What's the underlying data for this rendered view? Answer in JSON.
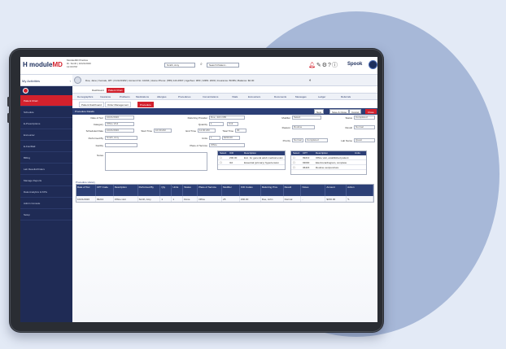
{
  "app": {
    "brand_prefix": "module",
    "brand_suffix": "MD",
    "header_info": [
      "ModuleMD Practice",
      "Dr. Smith | 10/21/2020",
      "12:00 PM"
    ],
    "provider_select": "Smith, Amy",
    "patient_search": "Search Patient...",
    "vendor_brand": "Spook",
    "icons": [
      "bell-icon",
      "tag-icon",
      "gear-icon",
      "help-icon",
      "info-icon",
      "user-avatar"
    ]
  },
  "sidebar": {
    "title": "My Activities",
    "items": [
      {
        "label": "Patient Chart",
        "active": true
      },
      {
        "label": "Schedule",
        "active": false
      },
      {
        "label": "E-Prescriptions",
        "active": false
      },
      {
        "label": "Encounter",
        "active": false
      },
      {
        "label": "E-Fax/Mail",
        "active": false
      },
      {
        "label": "Billing",
        "active": false
      },
      {
        "label": "Lab Results/Orders",
        "active": false
      },
      {
        "label": "Manage Reports",
        "active": false
      },
      {
        "label": "Data Analytics & KPIs",
        "active": false
      },
      {
        "label": "Admin Console",
        "active": false
      },
      {
        "label": "Setup",
        "active": false
      }
    ]
  },
  "toolbar": {
    "patient_line": "Doe, Jane | Female, 38Y | 01/12/1982 | Account No: 10234 | Home Phone: (555) 123-4567 | Age/Sex: 38/F | MRN: 2009 | Insurance: BCBS | Balance: $0.00",
    "end_icon": "◐"
  },
  "tabs": [
    {
      "label": "Dashboard",
      "active": false
    },
    {
      "label": "Patient Chart",
      "active": true
    }
  ],
  "menu": [
    "Demographics",
    "Insurance",
    "Problems",
    "Medications",
    "Allergies",
    "Procedures",
    "Immunizations",
    "Vitals",
    "Encounters",
    "Documents",
    "Messages",
    "Ledger",
    "Referrals"
  ],
  "subtabs": [
    {
      "label": "Patient Dashboard",
      "active": false
    },
    {
      "label": "Order Management",
      "active": false
    },
    {
      "label": "Procedure",
      "active": true
    }
  ],
  "section": {
    "title": "Procedure Details",
    "buttons": [
      {
        "label": "New",
        "red": false
      },
      {
        "label": "Save & Close",
        "red": false
      },
      {
        "label": "Cancel",
        "red": false
      },
      {
        "label": "Close",
        "red": true
      }
    ]
  },
  "form": {
    "date_label": "Date of Svc",
    "date_value": "10/21/2020",
    "category_label": "Category",
    "category_value": "Office Visit",
    "scheduled_label": "Scheduled Date",
    "scheduled_value": "10/21/2020",
    "start_time_label": "Start Time",
    "start_time_value": "10:30 AM",
    "performed_label": "Performed By",
    "performed_value": "Smith, Amy",
    "facility_label": "Facility",
    "referring_label": "Referring Provider",
    "referring_value": "Doe, John MD",
    "quantity_label": "Quantity",
    "quantity_value": "1",
    "unit_value": "Unit",
    "end_time_label": "End Time",
    "end_time_value": "11:00 AM",
    "total_time_label": "Total Time",
    "total_time_value": "30",
    "units_label": "Units",
    "units_value": "1",
    "units_amount": "$150.00",
    "place_label": "Place of Service",
    "place_value": "Office",
    "modifier_label": "Modifier",
    "modifier_value": "Select",
    "reason_label": "Reason",
    "reason_value": "Routine",
    "priority_label": "Priority",
    "priority_value": "Normal",
    "status_label": "Status",
    "status_value": "Completed",
    "notes_label": "Notes",
    "result_label": "Result",
    "result_value": "Normal",
    "lab_label": "Lab Name",
    "lab_value": "Quest"
  },
  "icd_table": {
    "headers": [
      "Select",
      "ICD",
      "Description"
    ],
    "rows": [
      {
        "code": "Z00.00",
        "desc": "Enc. for general adult medical exam"
      },
      {
        "code": "I10",
        "desc": "Essential (primary) hypertension"
      }
    ]
  },
  "cpt_table": {
    "headers": [
      "Select",
      "CPT",
      "Description",
      "Units"
    ],
    "rows": [
      {
        "code": "99213",
        "desc": "Office visit, established patient"
      },
      {
        "code": "93000",
        "desc": "Electrocardiogram, complete"
      },
      {
        "code": "36415",
        "desc": "Routine venipuncture"
      }
    ]
  },
  "grid": {
    "label": "Procedure History",
    "headers": [
      "Date of Svc",
      "CPT Code",
      "Description",
      "Performed By",
      "Qty",
      "Units",
      "Status",
      "Place of Service",
      "Modifier",
      "ICD Codes",
      "Referring Prov",
      "Result",
      "Notes",
      "Amount",
      "Action"
    ],
    "row": [
      "10/21/2020",
      "99213",
      "Office visit",
      "Smith, Amy",
      "1",
      "1",
      "Done",
      "Office",
      "25",
      "Z00.00",
      "Doe, John",
      "Normal",
      "-",
      "$150.00",
      "✎"
    ]
  }
}
